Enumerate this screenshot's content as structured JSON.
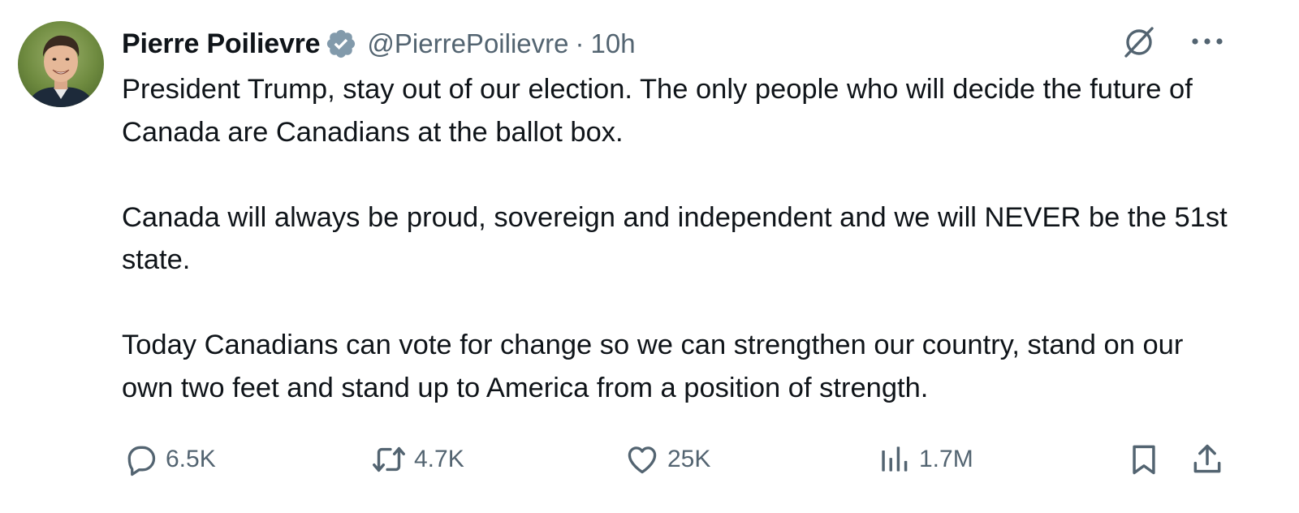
{
  "tweet": {
    "author": {
      "display_name": "Pierre Poilievre",
      "handle": "@PierrePoilievre",
      "verified": true,
      "verified_color": "#829aab"
    },
    "separator": "·",
    "time": "10h",
    "paragraphs": [
      "President Trump, stay out of our election. The only people who will decide the future of Canada are Canadians at the ballot box.",
      "Canada will always be proud, sovereign and independent and we will NEVER be the 51st state.",
      "Today Canadians can vote for change so we can strengthen our country, stand on our own two feet and stand up to America from a position of strength."
    ],
    "metrics": {
      "replies": "6.5K",
      "reposts": "4.7K",
      "likes": "25K",
      "views": "1.7M"
    },
    "icons": {
      "grok": "grok-icon",
      "more": "more-icon",
      "reply": "reply-icon",
      "repost": "repost-icon",
      "like": "heart-icon",
      "views": "views-icon",
      "bookmark": "bookmark-icon",
      "share": "share-icon"
    },
    "colors": {
      "text": "#0f1419",
      "muted": "#536471",
      "background": "#ffffff"
    }
  }
}
